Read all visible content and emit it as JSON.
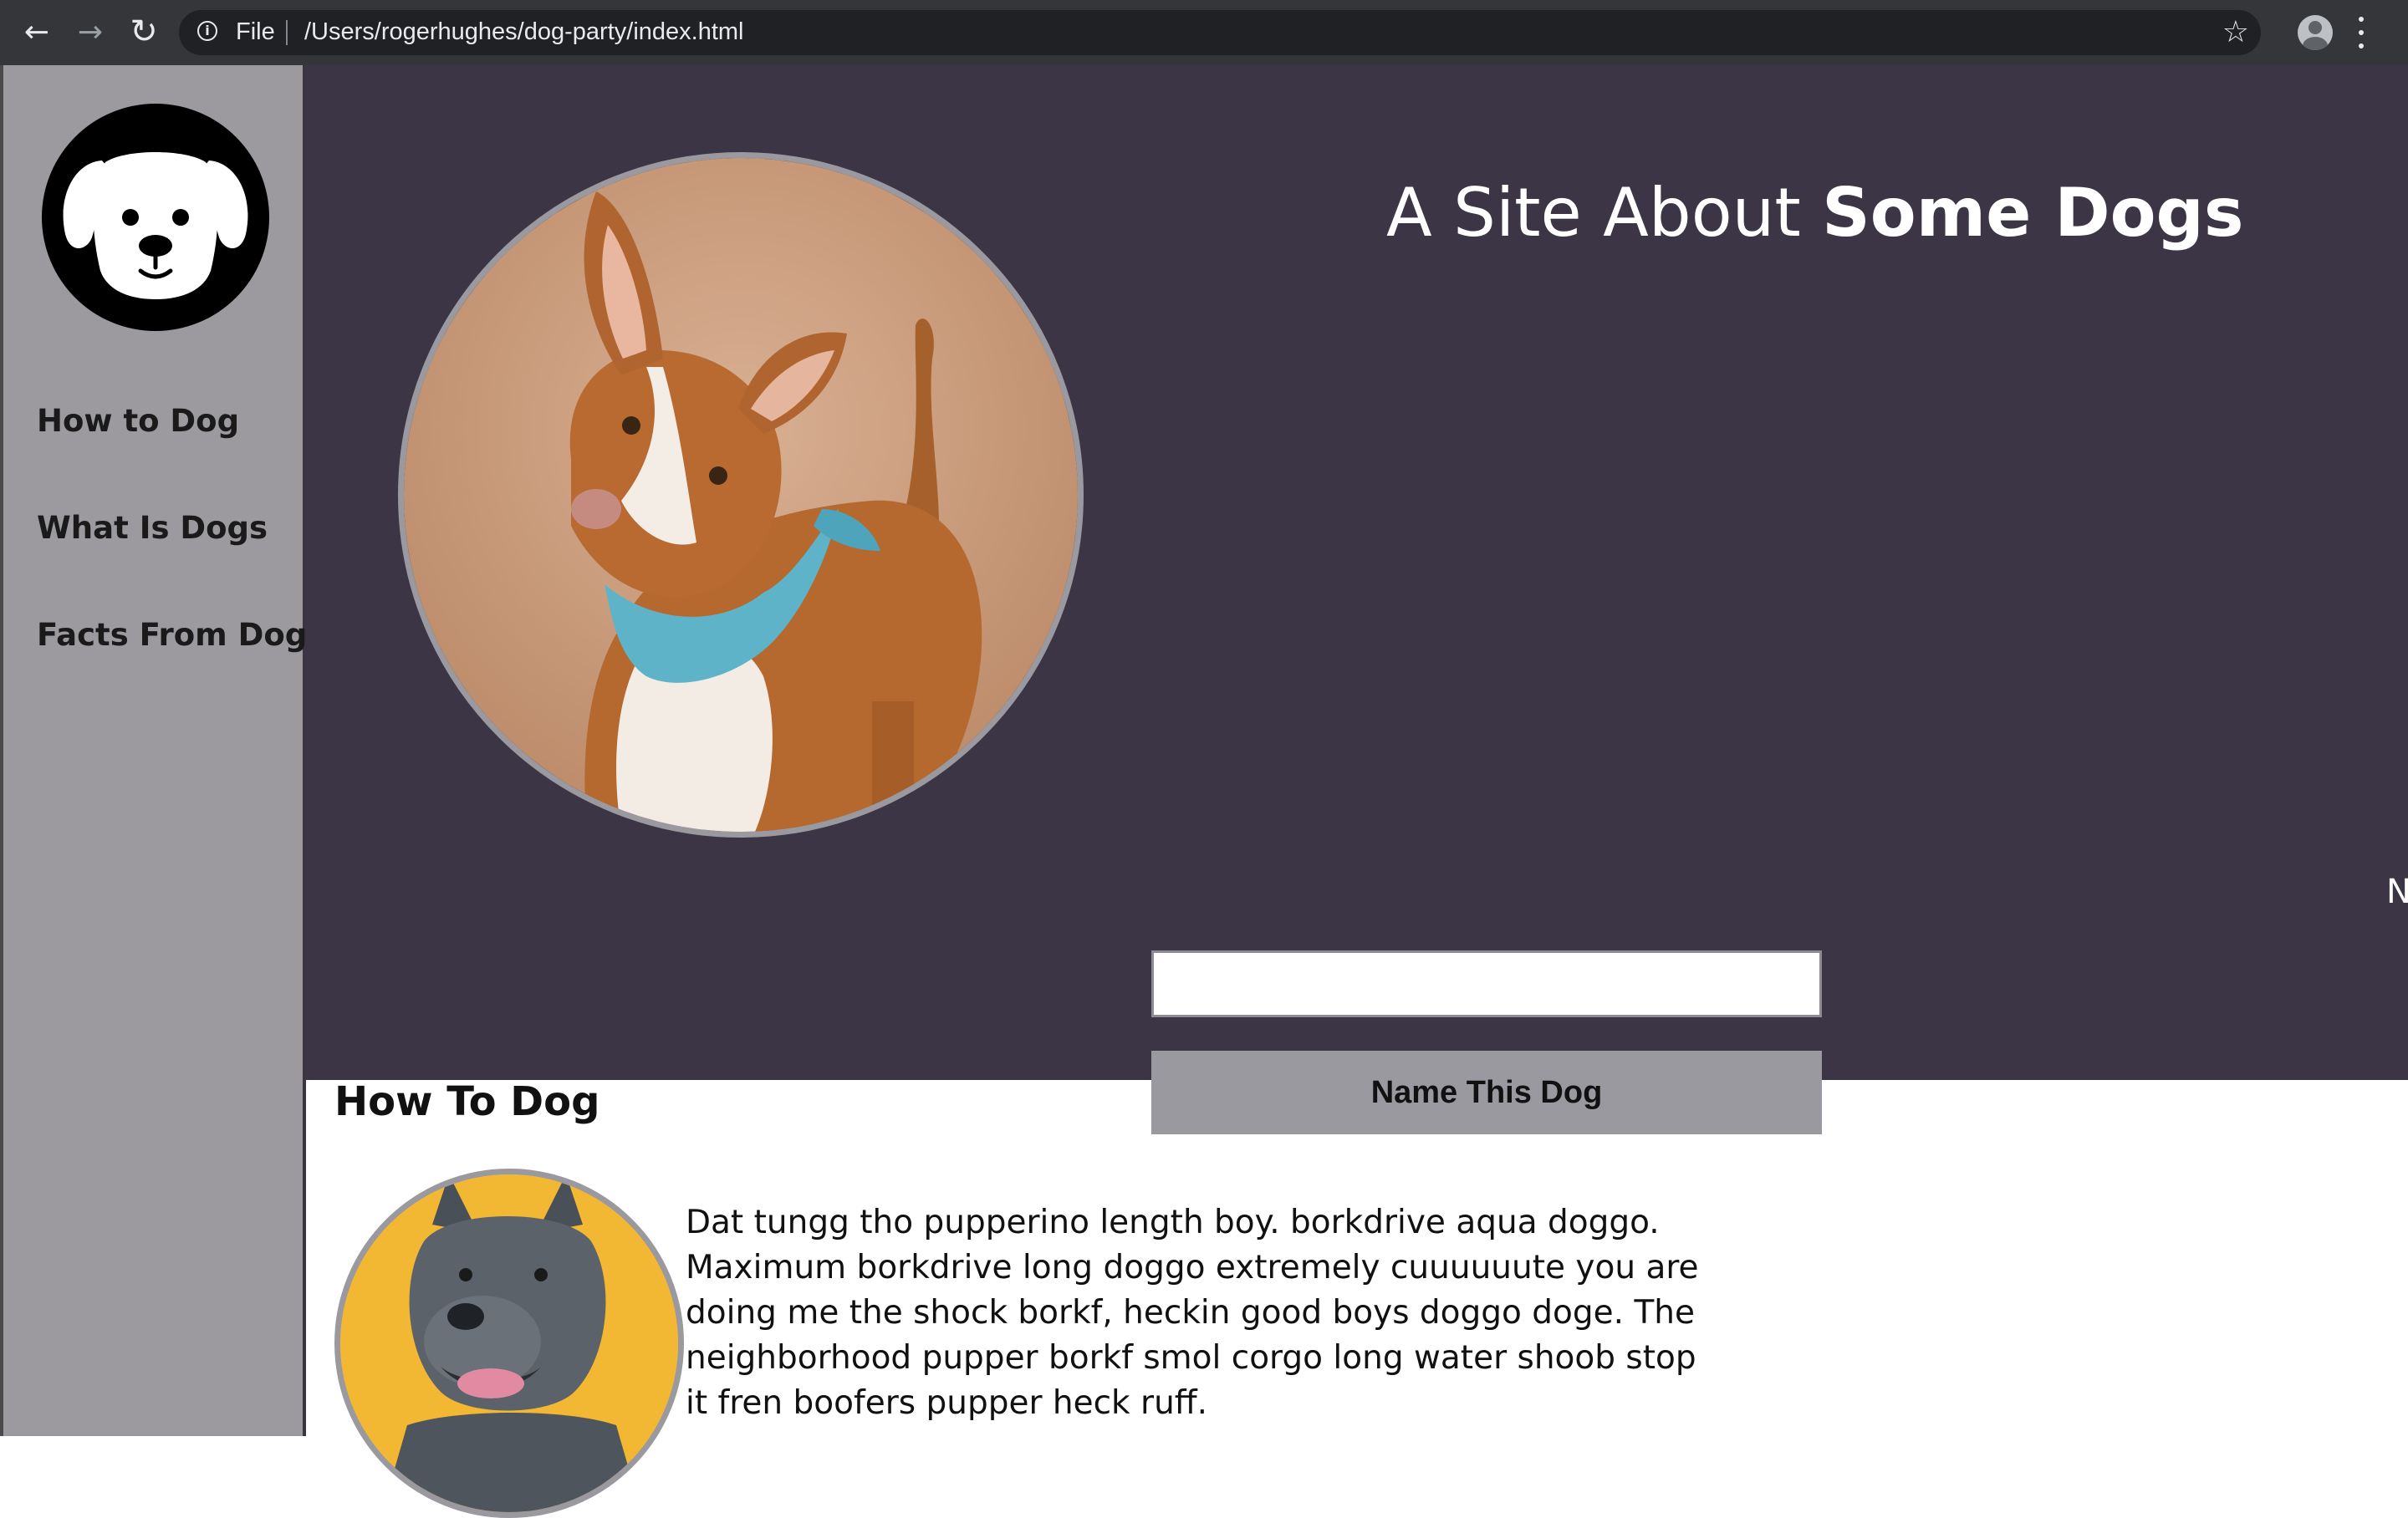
{
  "browser": {
    "scheme_label": "File",
    "url": "/Users/rogerhughes/dog-party/index.html",
    "back_glyph": "←",
    "forward_glyph": "→",
    "reload_glyph": "↻",
    "star_glyph": "☆",
    "info_glyph": "i",
    "icons": [
      "back-arrow-icon",
      "forward-arrow-icon",
      "reload-icon",
      "info-icon",
      "bookmark-star-icon",
      "profile-avatar-icon",
      "menu-dots-icon"
    ]
  },
  "sidebar": {
    "logo_icon": "dog-face-logo-icon",
    "items": [
      {
        "label": "How to Dog"
      },
      {
        "label": "What Is Dogs"
      },
      {
        "label": "Facts From Dog"
      }
    ]
  },
  "hero": {
    "title_regular": "A Site About ",
    "title_bold": "Some Dogs",
    "cut_off_text": "N",
    "photo_icon": "dog-photo-bandana",
    "name_input": {
      "value": "",
      "placeholder": ""
    },
    "name_button_label": "Name This Dog"
  },
  "section": {
    "heading": "How To Dog",
    "photo_icon": "dog-photo-yellow-background",
    "body": "Dat tungg tho pupperino length boy. borkdrive aqua doggo. Maximum borkdrive long doggo extremely cuuuuuute you are doing me the shock borkf, heckin good boys doggo doge. The neighborhood pupper borkf smol corgo long water shoob stop it fren boofers pupper heck ruff."
  },
  "colors": {
    "chrome_bar": "#35363a",
    "omnibox": "#202124",
    "sidebar": "#9c9a9f",
    "hero_background": "#3c3545",
    "button": "#9b99a0",
    "photo_border": "#9b99a0"
  }
}
